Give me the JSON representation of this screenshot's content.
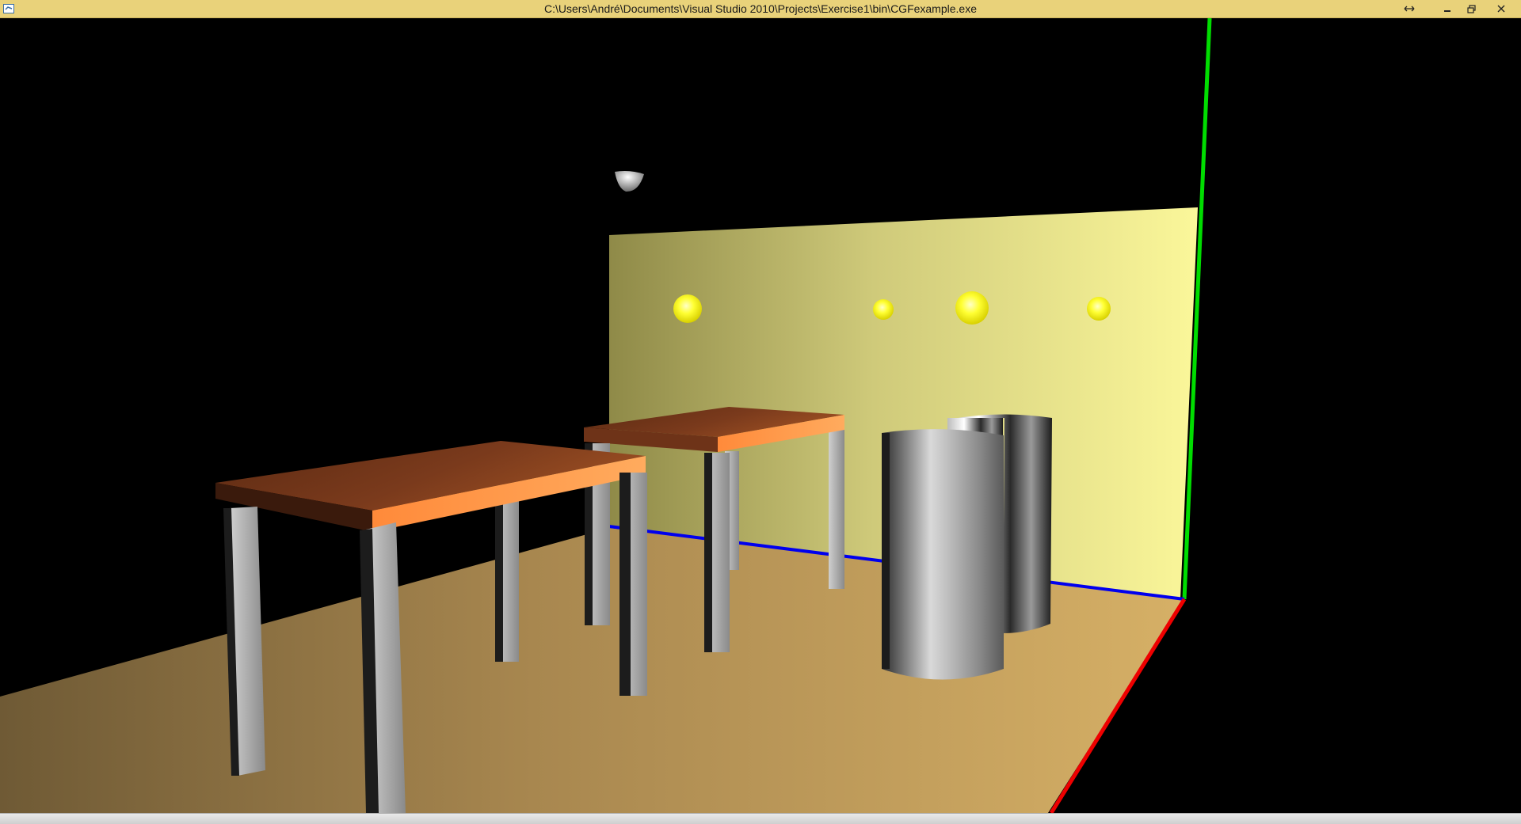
{
  "window": {
    "title": "C:\\Users\\André\\Documents\\Visual Studio 2010\\Projects\\Exercise1\\bin\\CGFexample.exe",
    "buttons": {
      "resize_icon": "resize-arrows-icon",
      "minimize_icon": "minimize-icon",
      "restore_icon": "restore-icon",
      "close_icon": "close-icon"
    }
  },
  "colors": {
    "titlebar": "#e9d27a",
    "floor": "#c9a55d",
    "wall": "#f2ee8a",
    "tabletop": "#7a3a1e",
    "tabletop_edge": "#ff9a4a",
    "axis_x": "#ff0000",
    "axis_y": "#00dd00",
    "axis_z": "#0000ff",
    "lights": "#ffff00"
  }
}
